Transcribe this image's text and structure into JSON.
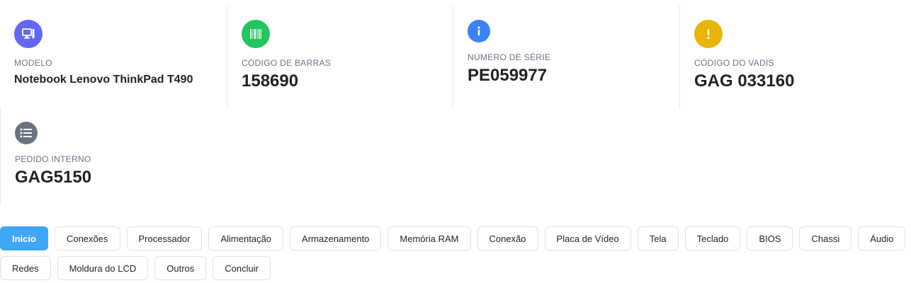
{
  "colors": {
    "modelo_icon": "#6366f1",
    "barras_icon": "#22c55e",
    "serie_icon": "#3b82f6",
    "vadis_icon": "#eab308",
    "pedido_icon": "#6b7280",
    "active_tab": "#3ea6f2"
  },
  "info_cards": {
    "modelo": {
      "icon": "computer-icon",
      "label": "MODELO",
      "value": "Notebook Lenovo ThinkPad T490"
    },
    "codigo_barras": {
      "icon": "barcode-icon",
      "label": "CÓDIGO DE BARRAS",
      "value": "158690"
    },
    "numero_serie": {
      "icon": "info-icon",
      "label": "NÚMERO DE SÉRIE",
      "value": "PE059977"
    },
    "codigo_vadis": {
      "icon": "exclamation-icon",
      "label": "CÓDIGO DO VADIS",
      "value": "GAG 033160"
    },
    "pedido_interno": {
      "icon": "list-icon",
      "label": "PEDIDO INTERNO",
      "value": "GAG5150"
    }
  },
  "tabs": [
    "Inicio",
    "Conexões",
    "Processador",
    "Alimentação",
    "Armazenamento",
    "Memória RAM",
    "Conexão",
    "Placa de Vídeo",
    "Tela",
    "Teclado",
    "BIOS",
    "Chassi",
    "Áudio",
    "Redes",
    "Moldura do LCD",
    "Outros",
    "Concluir"
  ],
  "active_tab": "Inicio"
}
